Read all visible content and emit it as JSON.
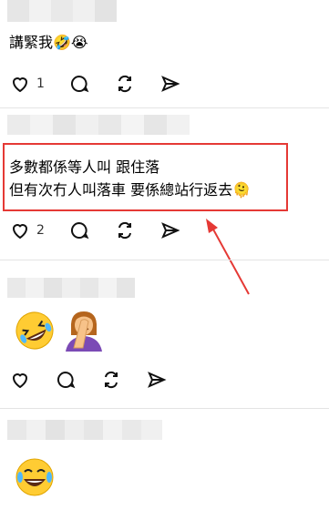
{
  "accent": "#e53935",
  "posts": [
    {
      "text_lines": [
        "講緊我🤣😭"
      ],
      "actions": {
        "like_count": "1"
      }
    },
    {
      "text_lines": [
        "多數都係等人叫 跟住落",
        "但有次冇人叫落車 要係總站行返去🫠"
      ],
      "actions": {
        "like_count": "2"
      },
      "annotation": "red-highlight-box-with-arrow"
    },
    {
      "reaction_emojis": [
        "rolling-on-floor-laughing",
        "person-facepalming"
      ],
      "actions": {
        "like_count": ""
      }
    },
    {
      "reaction_emojis": [
        "face-with-tears-of-joy"
      ]
    }
  ],
  "icons": [
    "heart-icon",
    "comment-icon",
    "repost-icon",
    "share-icon"
  ]
}
